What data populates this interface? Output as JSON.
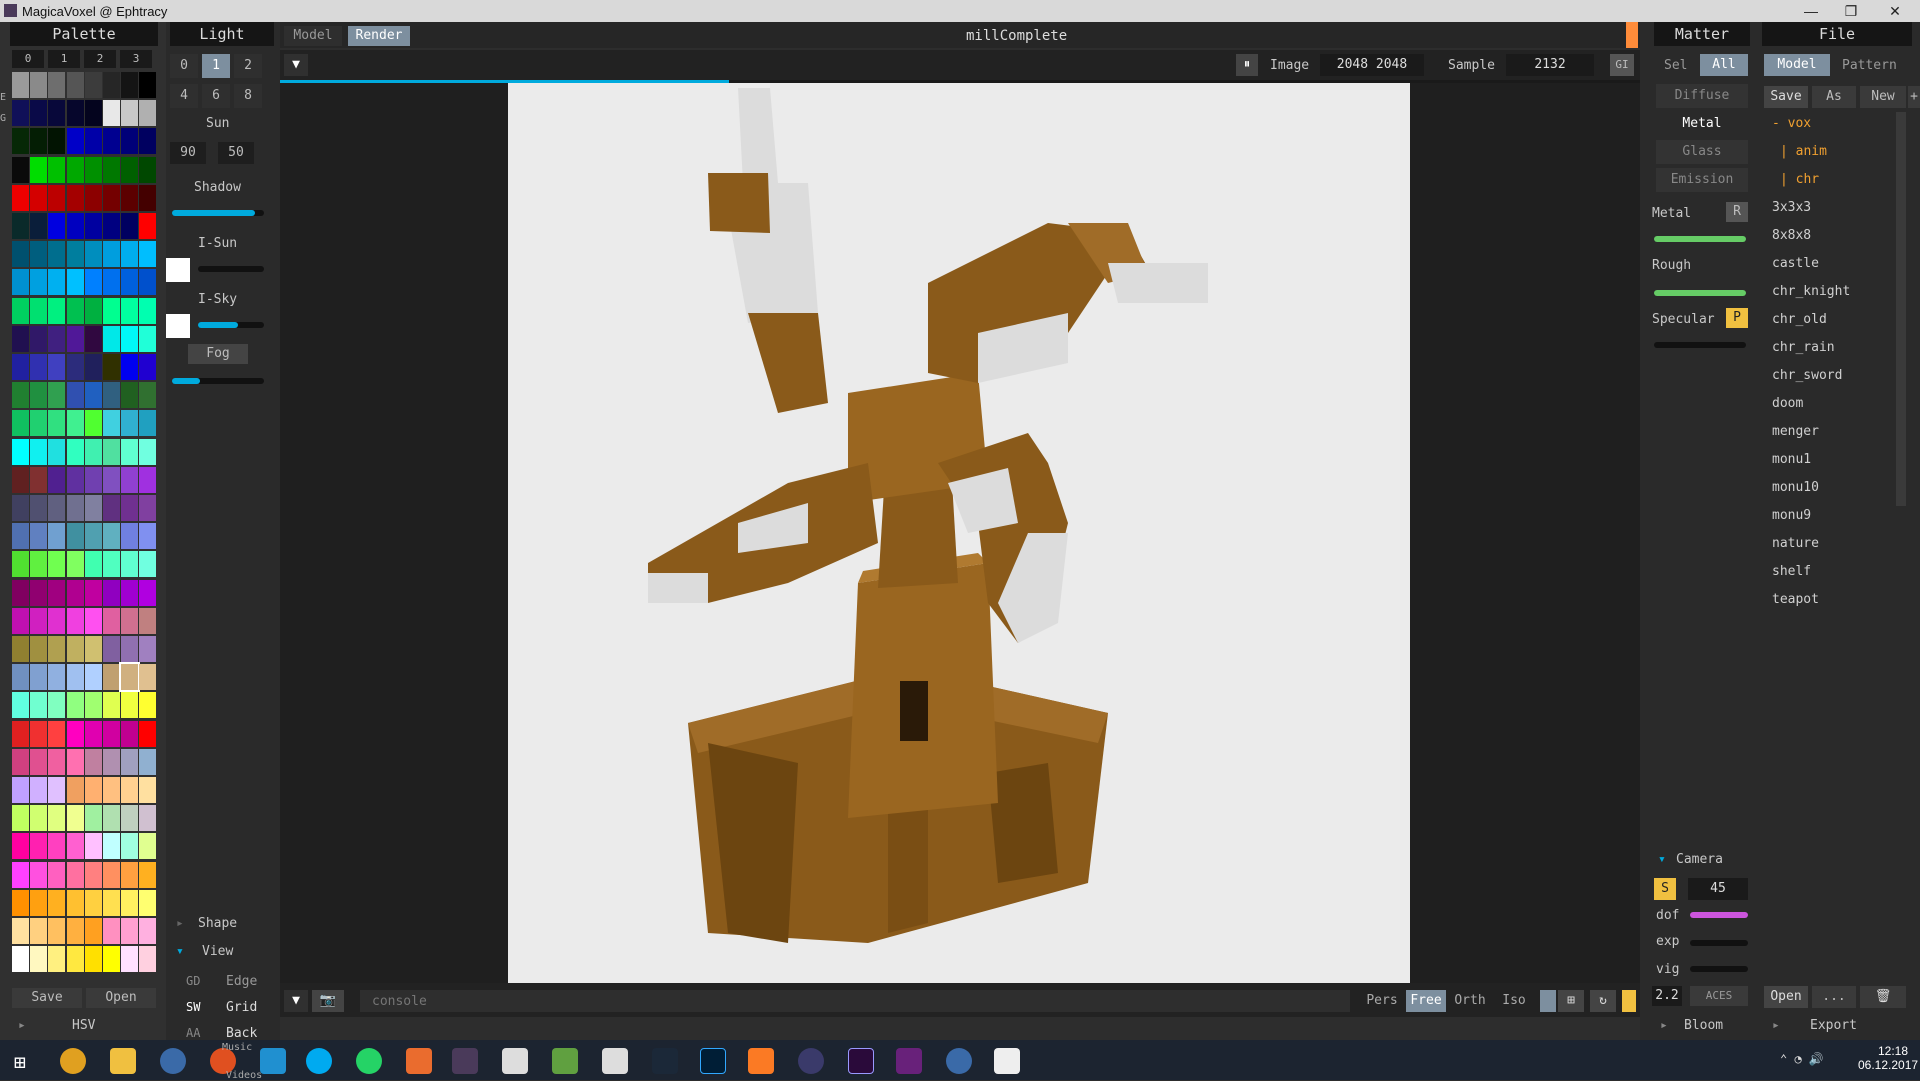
{
  "window": {
    "title": "MagicaVoxel @ Ephtracy",
    "min": "—",
    "max": "❐",
    "close": "✕"
  },
  "palette": {
    "header": "Palette",
    "pages": [
      "0",
      "1",
      "2",
      "3"
    ],
    "side_letters": [
      "E",
      "G"
    ],
    "save": "Save",
    "open": "Open",
    "hsv": "HSV",
    "colors": [
      [
        "#9a9a9a",
        "#8a8a8a",
        "#6e6e6e",
        "#555555",
        "#3c3c3c",
        "#262626",
        "#141414",
        "#000000"
      ],
      [
        "#101058",
        "#0a0a48",
        "#08083a",
        "#06062c",
        "#04041e",
        "#e8e8e8",
        "#c8c8c8",
        "#b0b0b0"
      ],
      [
        "#062806",
        "#041e04",
        "#021402",
        "#0000c8",
        "#0000a8",
        "#000090",
        "#000078",
        "#000060"
      ],
      [
        "#0a0a0a",
        "#00dd00",
        "#00c000",
        "#00a800",
        "#009000",
        "#007800",
        "#006000",
        "#004800"
      ],
      [
        "#ee0000",
        "#d40000",
        "#bc0000",
        "#a40000",
        "#8c0000",
        "#740000",
        "#5c0000",
        "#440000"
      ],
      [
        "#0a2a2a",
        "#0a1e3a",
        "#0000e0",
        "#0000c0",
        "#0000a0",
        "#000080",
        "#000060",
        "#ff0000"
      ],
      [
        "#00506e",
        "#005e7e",
        "#006e8e",
        "#007e9e",
        "#008ebe",
        "#009ede",
        "#00aeee",
        "#00befe"
      ],
      [
        "#0090d0",
        "#00a0e0",
        "#00b0f0",
        "#00c0ff",
        "#0080ff",
        "#0070ee",
        "#0060dd",
        "#0050cc"
      ],
      [
        "#00d060",
        "#00e070",
        "#00f080",
        "#00c050",
        "#00b040",
        "#00ff90",
        "#00ffa0",
        "#00ffb0"
      ],
      [
        "#201050",
        "#301868",
        "#402080",
        "#501898",
        "#300840",
        "#00e8e8",
        "#00f8f8",
        "#20ffd8"
      ],
      [
        "#2020a0",
        "#3030b0",
        "#4040c0",
        "#2c2c7c",
        "#20205c",
        "#303000",
        "#0000f0",
        "#2000d0"
      ],
      [
        "#208030",
        "#209040",
        "#30a050",
        "#3050b0",
        "#2060c0",
        "#306080",
        "#206020",
        "#307030"
      ],
      [
        "#10c060",
        "#20d070",
        "#30e080",
        "#40f090",
        "#50ff30",
        "#40d0e0",
        "#30b0d0",
        "#20a0c0"
      ],
      [
        "#00ffff",
        "#10f0f0",
        "#20e0e0",
        "#30ffc0",
        "#40f0b0",
        "#50e0a0",
        "#60ffd0",
        "#70ffe0"
      ],
      [
        "#602020",
        "#803030",
        "#502090",
        "#6030a0",
        "#7040b0",
        "#8050c0",
        "#9040d0",
        "#a030e0"
      ],
      [
        "#404060",
        "#505070",
        "#606080",
        "#707090",
        "#8080a0",
        "#603080",
        "#703090",
        "#8040a0"
      ],
      [
        "#5070b0",
        "#6080c0",
        "#70a0d0",
        "#4090a0",
        "#50a0b0",
        "#60b0c0",
        "#7080e0",
        "#8090f0"
      ],
      [
        "#50e030",
        "#60f040",
        "#70ff50",
        "#80ff60",
        "#40ffb0",
        "#50ffc0",
        "#60ffd0",
        "#70ffe0"
      ],
      [
        "#800060",
        "#900070",
        "#a00080",
        "#b00090",
        "#c000a0",
        "#9000c0",
        "#a000d0",
        "#b000e0"
      ],
      [
        "#c010b0",
        "#d020c0",
        "#e030d0",
        "#f040e0",
        "#ff50f0",
        "#e060a0",
        "#d07090",
        "#c08080"
      ],
      [
        "#908030",
        "#a09040",
        "#b0a050",
        "#c0b060",
        "#d0c070",
        "#8060a0",
        "#9070b0",
        "#a080c0"
      ],
      [
        "#7090c0",
        "#80a0d0",
        "#90b0e0",
        "#a0c0f0",
        "#b0d0ff",
        "#c0a070",
        "#d0b080",
        "#e0c090"
      ],
      [
        "#60ffe0",
        "#70ffd0",
        "#80ffc0",
        "#90ff80",
        "#a0ff70",
        "#e0ff50",
        "#f0ff40",
        "#ffff30"
      ],
      [
        "#e02020",
        "#f03030",
        "#ff4040",
        "#ff00c0",
        "#e000b0",
        "#d000a0",
        "#c00090",
        "#ff0000"
      ],
      [
        "#d04080",
        "#e05090",
        "#f060a0",
        "#ff70b0",
        "#c080a0",
        "#b090b0",
        "#a0a0c0",
        "#90b0d0"
      ],
      [
        "#c0a0ff",
        "#d0b0ff",
        "#e0c0ff",
        "#f0a060",
        "#ffb070",
        "#ffc080",
        "#ffd090",
        "#ffe0a0"
      ],
      [
        "#c0ff60",
        "#d0ff70",
        "#e0ff80",
        "#f0ff90",
        "#a0f0a0",
        "#b0e0b0",
        "#c0d0c0",
        "#d0c0d0"
      ],
      [
        "#ff00a0",
        "#ff20b0",
        "#ff40c0",
        "#ff60d0",
        "#ffc0ff",
        "#c0ffff",
        "#a0ffe0",
        "#e0ff90"
      ],
      [
        "#ff40ff",
        "#ff50e0",
        "#ff60c0",
        "#ff70a0",
        "#ff8080",
        "#ff9060",
        "#ffa040",
        "#ffb020"
      ],
      [
        "#ff9000",
        "#ffa010",
        "#ffb020",
        "#ffc030",
        "#ffd040",
        "#ffe050",
        "#fff060",
        "#ffff70"
      ],
      [
        "#ffe0a0",
        "#ffd080",
        "#ffc060",
        "#ffb040",
        "#ffa020",
        "#ff90c0",
        "#ffa0d0",
        "#ffb0e0"
      ],
      [
        "#ffffff",
        "#fff8c0",
        "#fff080",
        "#ffe840",
        "#ffe000",
        "#ffff00",
        "#ffe0ff",
        "#ffd0e0"
      ]
    ]
  },
  "light": {
    "header": "Light",
    "presets": [
      "0",
      "1",
      "2",
      "4",
      "6",
      "8"
    ],
    "sun_label": "Sun",
    "sun_values": [
      "90",
      "50"
    ],
    "shadow_label": "Shadow",
    "shadow_level": 0.9,
    "isun_label": "I-Sun",
    "isun_level": 0.0,
    "isky_label": "I-Sky",
    "isky_level": 0.6,
    "fog_label": "Fog",
    "fog_level": 0.3,
    "shape_label": "Shape",
    "view_label": "View",
    "view_buttons": [
      [
        "GD",
        "Edge"
      ],
      [
        "SW",
        "Grid"
      ],
      [
        "AA",
        "Back"
      ]
    ]
  },
  "viewport": {
    "tabs": [
      "Model",
      "Render"
    ],
    "title": "millComplete",
    "image_label": "Image",
    "image_size": "2048 2048",
    "sample_label": "Sample",
    "sample_value": "2132",
    "gi_label": "GI",
    "pause_icon": "⏸",
    "console_placeholder": "console",
    "projection": [
      "Pers",
      "Free",
      "Orth",
      "Iso"
    ],
    "progress": 0.33
  },
  "matter": {
    "header": "Matter",
    "sel": "Sel",
    "all": "All",
    "types": [
      "Diffuse",
      "Metal",
      "Glass",
      "Emission"
    ],
    "metal_label": "Metal",
    "metal_btn": "R",
    "rough_label": "Rough",
    "specular_label": "Specular",
    "specular_btn": "P",
    "camera_label": "Camera",
    "camera_s": "S",
    "camera_fov": "45",
    "dof_label": "dof",
    "exp_label": "exp",
    "vig_label": "vig",
    "gamma": "2.2",
    "aces": "ACES",
    "bloom": "Bloom"
  },
  "file": {
    "header": "File",
    "tabs": [
      "Model",
      "Pattern"
    ],
    "actions": [
      "Save",
      "As",
      "New",
      "+"
    ],
    "tree": [
      "- vox",
      "| anim",
      "| chr"
    ],
    "items": [
      "3x3x3",
      "8x8x8",
      "castle",
      "chr_knight",
      "chr_old",
      "chr_rain",
      "chr_sword",
      "doom",
      "menger",
      "monu1",
      "monu10",
      "monu9",
      "nature",
      "shelf",
      "teapot"
    ],
    "open": "Open",
    "more": "...",
    "export": "Export"
  },
  "taskbar": {
    "time": "12:18",
    "date": "06.12.2017",
    "tooltip1": "Music",
    "tooltip2": "Videos"
  },
  "colors": {
    "accent": "#00aadd",
    "selected_tab": "#7d8f9f",
    "wood": "#8a5a1a",
    "stone": "#d8d8d8"
  }
}
